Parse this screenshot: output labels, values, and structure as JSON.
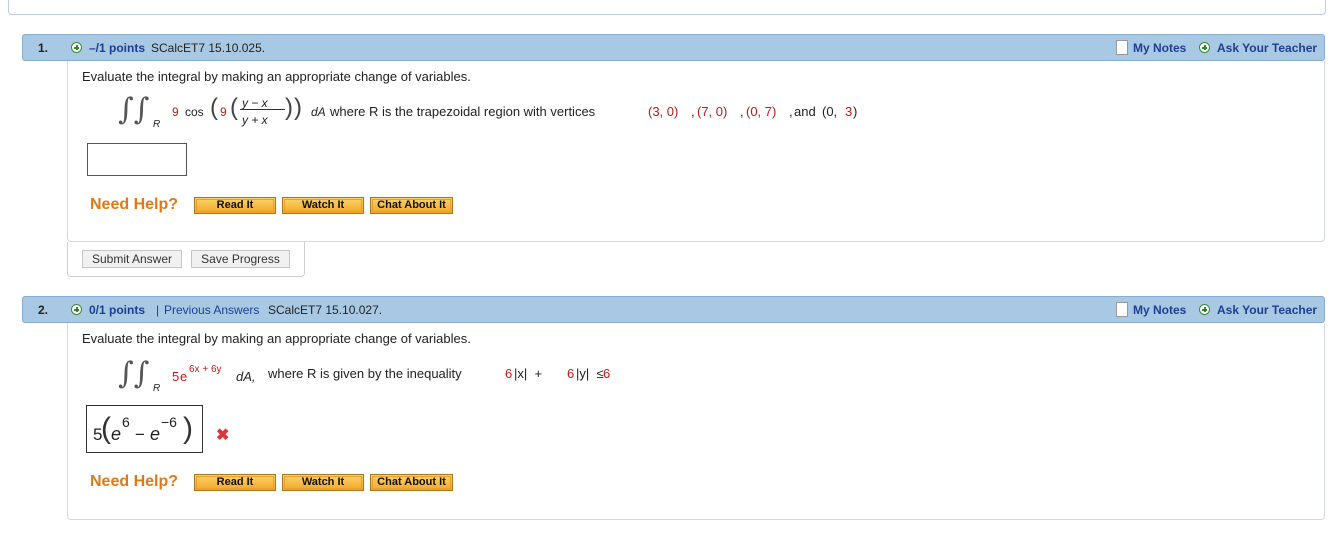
{
  "q1": {
    "number": "1.",
    "points": "–/1 points",
    "source": "SCalcET7 15.10.025.",
    "my_notes": "My Notes",
    "ask_teacher": "Ask Your Teacher",
    "prompt": "Evaluate the integral by making an appropriate change of variables.",
    "integral_sub": "R",
    "coef": "9",
    "cos": "cos",
    "inner_coef": "9",
    "frac_num": "y − x",
    "frac_den": "y + x",
    "dA": "dA",
    "where_text": "where R is the trapezoidal region with vertices",
    "v1": "(3, 0)",
    "v2": "(7, 0)",
    "v3": "(0, 7)",
    "and_word": "and",
    "v4a": "(0, ",
    "v4b": "3",
    "v4c": ")",
    "answer_value": "",
    "need_help": "Need Help?",
    "read_it": "Read It",
    "watch_it": "Watch It",
    "chat_it": "Chat About It",
    "submit": "Submit Answer",
    "save": "Save Progress"
  },
  "q2": {
    "number": "2.",
    "points": "0/1 points",
    "separator": "|",
    "previous_answers": "Previous Answers",
    "source": "SCalcET7 15.10.027.",
    "my_notes": "My Notes",
    "ask_teacher": "Ask Your Teacher",
    "prompt": "Evaluate the integral by making an appropriate change of variables.",
    "integral_sub": "R",
    "coef": "5",
    "base": "e",
    "exp": "6x + 6y",
    "dA": "dA,",
    "where_text": "where R is given by the inequality",
    "ineq_a": "6",
    "ineq_b": "|x|  +  ",
    "ineq_c": "6",
    "ineq_d": "|y|  ≤  ",
    "ineq_e": "6",
    "answer": {
      "coef": "5",
      "e1": "e",
      "exp1": "6",
      "minus": "−",
      "e2": "e",
      "exp2": "−6"
    },
    "status_icon": "incorrect-x-icon",
    "need_help": "Need Help?",
    "read_it": "Read It",
    "watch_it": "Watch It",
    "chat_it": "Chat About It"
  }
}
